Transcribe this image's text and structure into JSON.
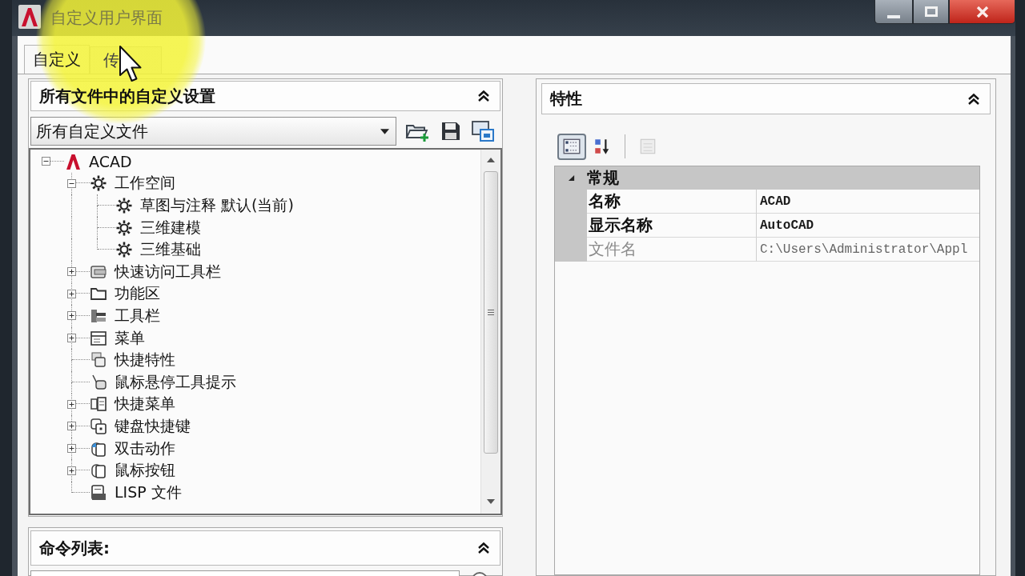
{
  "window": {
    "title": "自定义用户界面"
  },
  "tabs": [
    {
      "label": "自定义",
      "selected": true
    },
    {
      "label": "传",
      "selected": false
    }
  ],
  "customizations_panel": {
    "title": "所有文件中的自定义设置",
    "file_filter": {
      "value": "所有自定义文件"
    },
    "tree": [
      {
        "label": "ACAD",
        "kind": "file",
        "expanded": true,
        "children": [
          {
            "label": "工作空间",
            "kind": "workspaces",
            "expanded": true,
            "children": [
              {
                "label": "草图与注释 默认(当前)",
                "kind": "workspace"
              },
              {
                "label": "三维建模",
                "kind": "workspace"
              },
              {
                "label": "三维基础",
                "kind": "workspace"
              }
            ]
          },
          {
            "label": "快速访问工具栏",
            "kind": "quick_access_toolbars",
            "expanded": false
          },
          {
            "label": "功能区",
            "kind": "ribbon",
            "expanded": false
          },
          {
            "label": "工具栏",
            "kind": "toolbars",
            "expanded": false
          },
          {
            "label": "菜单",
            "kind": "menus",
            "expanded": false
          },
          {
            "label": "快捷特性",
            "kind": "quick_properties"
          },
          {
            "label": "鼠标悬停工具提示",
            "kind": "rollover_tooltips"
          },
          {
            "label": "快捷菜单",
            "kind": "shortcut_menus",
            "expanded": false
          },
          {
            "label": "键盘快捷键",
            "kind": "keyboard_shortcuts",
            "expanded": false
          },
          {
            "label": "双击动作",
            "kind": "double_click_actions",
            "expanded": false
          },
          {
            "label": "鼠标按钮",
            "kind": "mouse_buttons",
            "expanded": false
          },
          {
            "label": "LISP 文件",
            "kind": "lisp_files"
          }
        ]
      }
    ]
  },
  "command_list_panel": {
    "title": "命令列表:"
  },
  "properties_panel": {
    "title": "特性",
    "toolbar": [
      {
        "kind": "categorized",
        "selected": true,
        "disabled": false
      },
      {
        "kind": "alphabetical",
        "selected": false,
        "disabled": false
      },
      {
        "kind": "property_pages",
        "selected": false,
        "disabled": true
      }
    ],
    "groups": [
      {
        "label": "常规",
        "expanded": true,
        "rows": [
          {
            "name": "名称",
            "value": "ACAD",
            "read_only": false
          },
          {
            "name": "显示名称",
            "value": "AutoCAD",
            "read_only": false
          },
          {
            "name": "文件名",
            "value": "C:\\Users\\Administrator\\Appl",
            "read_only": true
          }
        ]
      }
    ]
  }
}
